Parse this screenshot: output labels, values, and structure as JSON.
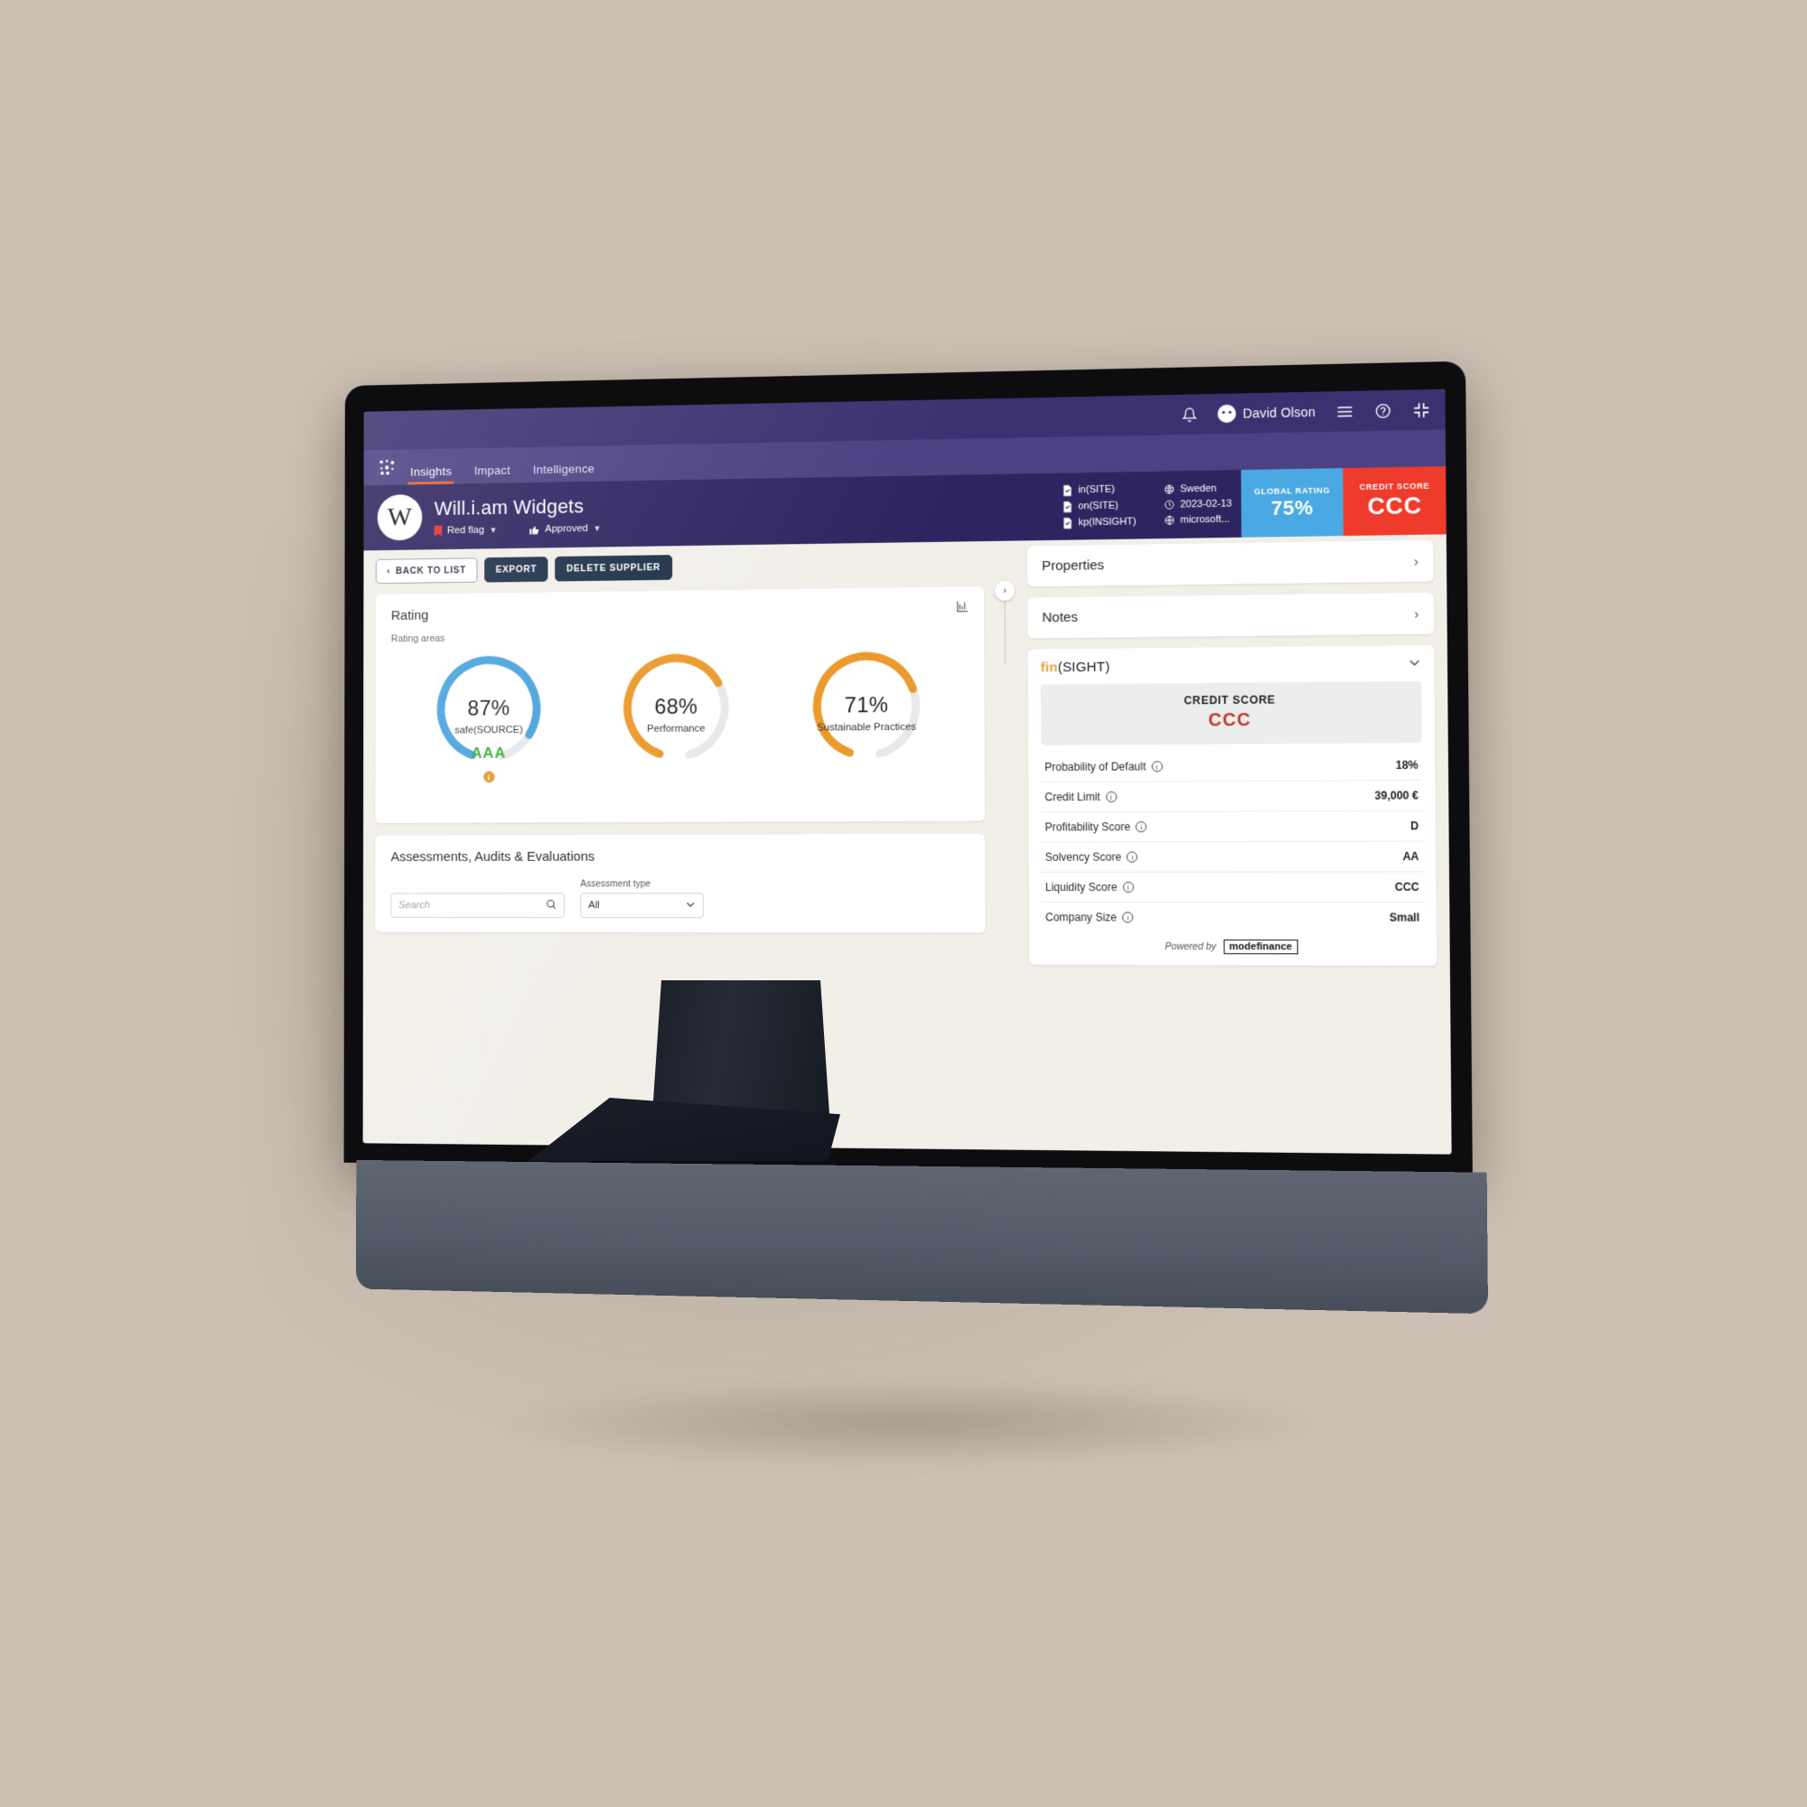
{
  "appbar": {
    "notifications_icon": "bell-icon",
    "user_name": "David Olson",
    "menu_icon": "hamburger-menu-icon",
    "help_icon": "question-mark-icon",
    "collapse_icon": "collapse-fullscreen-icon"
  },
  "nav": {
    "logo": "dots-grid-logo",
    "tabs": [
      {
        "label": "Insights",
        "active": true
      },
      {
        "label": "Impact",
        "active": false
      },
      {
        "label": "Intelligence",
        "active": false
      }
    ]
  },
  "hero": {
    "avatar_letter": "W",
    "company_name": "Will.i.am Widgets",
    "flag_status": "Red flag",
    "flag_color": "#e8312a",
    "approval_status": "Approved",
    "docs": [
      "in(SITE)",
      "on(SITE)",
      "kp(INSIGHT)"
    ],
    "facts": [
      {
        "icon": "globe-pin-icon",
        "value": "Sweden"
      },
      {
        "icon": "clock-icon",
        "value": "2023-02-13"
      },
      {
        "icon": "web-icon",
        "value": "microsoft..."
      }
    ],
    "global_rating": {
      "label": "GLOBAL RATING",
      "value": "75%",
      "color": "#4aa9e2"
    },
    "credit_score": {
      "label": "CREDIT SCORE",
      "value": "CCC",
      "color": "#ef3b2b"
    }
  },
  "actions": {
    "back": "BACK TO LIST",
    "export": "EXPORT",
    "delete": "DELETE SUPPLIER"
  },
  "rating_card": {
    "title": "Rating",
    "chart_icon": "bar-chart-icon",
    "subtitle": "Rating areas"
  },
  "assessments": {
    "title": "Assessments, Audits & Evaluations",
    "search_placeholder": "Search",
    "search_value": "",
    "type_label": "Assessment type",
    "type_value": "All"
  },
  "right": {
    "properties": "Properties",
    "notes": "Notes",
    "fin_logo_accent": "fin",
    "fin_logo_rest": "(SIGHT)",
    "credit_label": "CREDIT SCORE",
    "credit_value": "CCC",
    "rows": [
      {
        "key": "Probability of Default",
        "value": "18%"
      },
      {
        "key": "Credit Limit",
        "value": "39,000 €"
      },
      {
        "key": "Profitability Score",
        "value": "D"
      },
      {
        "key": "Solvency Score",
        "value": "AA"
      },
      {
        "key": "Liquidity Score",
        "value": "CCC"
      },
      {
        "key": "Company Size",
        "value": "Small"
      }
    ],
    "powered_by": "Powered by",
    "powered_brand": "modefinance"
  },
  "chart_data": {
    "type": "pie",
    "title": "Rating areas",
    "gauges": [
      {
        "label": "safe(SOURCE)",
        "value": 87,
        "unit": "%",
        "grade": "AAA",
        "color": "#4aa3dd",
        "track": "#e7e8ea",
        "grade_color": "#3eae3e",
        "has_info": true
      },
      {
        "label": "Performance",
        "value": 68,
        "unit": "%",
        "grade": "",
        "color": "#eb9a2b",
        "track": "#e7e8ea",
        "grade_color": "",
        "has_info": false
      },
      {
        "label": "Sustainable Practices",
        "value": 71,
        "unit": "%",
        "grade": "",
        "color": "#eb9a2b",
        "track": "#e7e8ea",
        "grade_color": "",
        "has_info": false
      }
    ],
    "ylim": [
      0,
      100
    ]
  }
}
